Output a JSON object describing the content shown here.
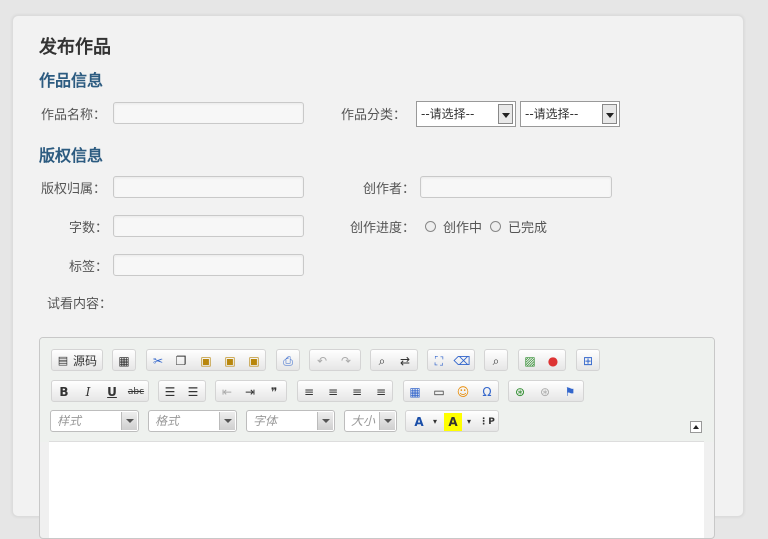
{
  "page_title": "发布作品",
  "sections": {
    "work_info": "作品信息",
    "copyright_info": "版权信息"
  },
  "fields": {
    "work_name": {
      "label": "作品名称：",
      "value": ""
    },
    "work_category": {
      "label": "作品分类：",
      "select1": "--请选择--",
      "select2": "--请选择--"
    },
    "copyright_owner": {
      "label": "版权归属：",
      "value": ""
    },
    "creator": {
      "label": "创作者：",
      "value": ""
    },
    "word_count": {
      "label": "字数：",
      "value": ""
    },
    "progress": {
      "label": "创作进度：",
      "options": [
        "创作中",
        "已完成"
      ],
      "selected": null
    },
    "tags": {
      "label": "标签：",
      "value": ""
    },
    "preview_content": {
      "label": "试看内容："
    }
  },
  "editor": {
    "source_label": "源码",
    "comboboxes": {
      "style": "样式",
      "format": "格式",
      "font": "字体",
      "size": "大小"
    },
    "content": ""
  }
}
